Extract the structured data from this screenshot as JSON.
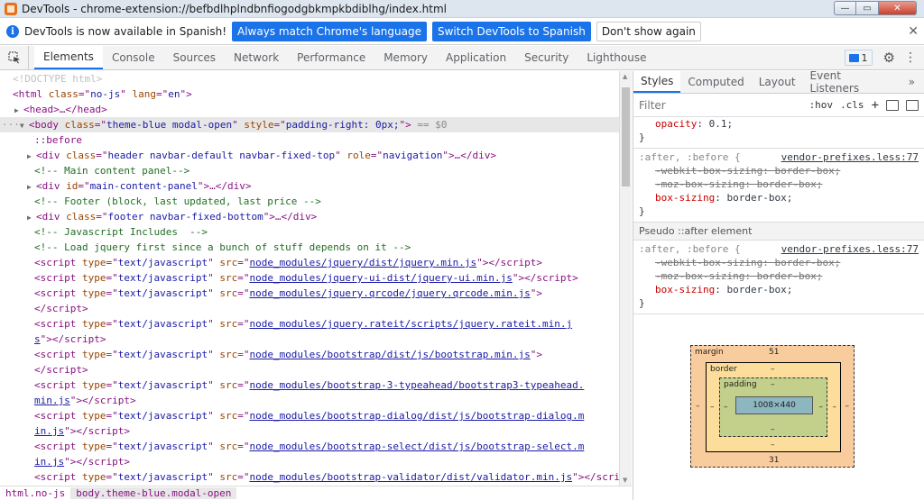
{
  "window": {
    "title": "DevTools - chrome-extension://befbdlhplndbnfiogodgbkmpkbdiblhg/index.html",
    "minimize_glyph": "—",
    "maximize_glyph": "▭",
    "close_glyph": "✕"
  },
  "infobar": {
    "message": "DevTools is now available in Spanish!",
    "btn_match": "Always match Chrome's language",
    "btn_switch": "Switch DevTools to Spanish",
    "btn_dismiss": "Don't show again"
  },
  "tabs": [
    "Elements",
    "Console",
    "Sources",
    "Network",
    "Performance",
    "Memory",
    "Application",
    "Security",
    "Lighthouse"
  ],
  "issues_count": "1",
  "elements": {
    "doctype": "<!DOCTYPE html>",
    "html_line": {
      "tag": "html",
      "a1": "class",
      "v1": "no-js",
      "a2": "lang",
      "v2": "en"
    },
    "head_line": "<head>…</head>",
    "body": {
      "a1": "class",
      "v1": "theme-blue modal-open",
      "a2": "style",
      "v2": "padding-right: 0px;",
      "suffix": " == $0"
    },
    "before": "::before",
    "header_div": {
      "class": "header navbar-default navbar-fixed-top",
      "role": "navigation"
    },
    "comment_main": "<!-- Main content panel-->",
    "main_div_id": "main-content-panel",
    "comment_footer": "<!-- Footer (block, last updated, last price -->",
    "footer_div_class": "footer navbar-fixed-bottom",
    "comment_js": "<!-- Javascript Includes  -->",
    "comment_jquery": "<!-- Load jquery first since a bunch of stuff depends on it -->",
    "scripts": [
      {
        "src": "node_modules/jquery/dist/jquery.min.js",
        "wrap": ""
      },
      {
        "src": "node_modules/jquery-ui-dist/jquery-ui.min.js",
        "wrap": ""
      },
      {
        "src": "node_modules/jquery.qrcode/jquery.qrcode.min.js",
        "wrap": ""
      },
      {
        "src": "node_modules/jquery.rateit/scripts/jquery.rateit.min.j",
        "wrap": "s"
      },
      {
        "src": "node_modules/bootstrap/dist/js/bootstrap.min.js",
        "wrap": ""
      },
      {
        "src": "node_modules/bootstrap-3-typeahead/bootstrap3-typeahead.",
        "wrap": "min.js"
      },
      {
        "src": "node_modules/bootstrap-dialog/dist/js/bootstrap-dialog.m",
        "wrap": "in.js"
      },
      {
        "src": "node_modules/bootstrap-select/dist/js/bootstrap-select.m",
        "wrap": "in.js"
      },
      {
        "src": "node_modules/bootstrap-validator/dist/validator.min.js",
        "wrap": ""
      }
    ],
    "script_type": "text/javascript"
  },
  "breadcrumbs": [
    "html.no-js",
    "body.theme-blue.modal-open"
  ],
  "styles_tabs": [
    "Styles",
    "Computed",
    "Layout",
    "Event Listeners"
  ],
  "filter": {
    "placeholder": "Filter",
    "hov": ":hov",
    "cls": ".cls",
    "plus": "+"
  },
  "rules": {
    "opacity": {
      "prop": "opacity",
      "value": "0.1"
    },
    "r1": {
      "selector": ":after, :before {",
      "source": "vendor-prefixes.less:77",
      "props": [
        {
          "name": "-webkit-box-sizing",
          "value": "border-box",
          "strike": true
        },
        {
          "name": "-moz-box-sizing",
          "value": "border-box",
          "strike": true
        },
        {
          "name": "box-sizing",
          "value": "border-box",
          "strike": false
        }
      ]
    },
    "pseudo_header": "Pseudo ::after element",
    "r2": {
      "selector": ":after, :before {",
      "source": "vendor-prefixes.less:77",
      "props": [
        {
          "name": "-webkit-box-sizing",
          "value": "border-box",
          "strike": true
        },
        {
          "name": "-moz-box-sizing",
          "value": "border-box",
          "strike": true
        },
        {
          "name": "box-sizing",
          "value": "border-box",
          "strike": false
        }
      ]
    }
  },
  "boxmodel": {
    "margin_label": "margin",
    "margin_top": "51",
    "margin_bottom": "31",
    "margin_left": "–",
    "margin_right": "–",
    "border_label": "border",
    "border_val": "–",
    "padding_label": "padding",
    "padding_val": "–",
    "content": "1008×440"
  }
}
